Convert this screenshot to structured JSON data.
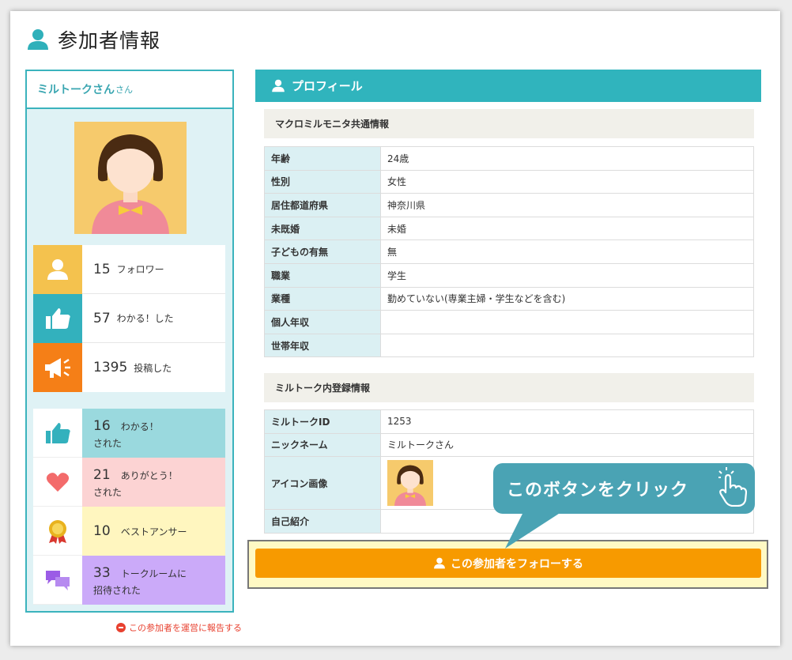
{
  "page": {
    "title": "参加者情報"
  },
  "colors": {
    "teal": "#30b4bd",
    "orange": "#f79a00",
    "callout": "#4aa3b4",
    "report": "#e8402f"
  },
  "user_card": {
    "name": "ミルトークさん",
    "suffix": "さん",
    "stats": [
      {
        "count": "15",
        "label": "フォロワー",
        "icon": "person-icon",
        "color": "#f4c24e"
      },
      {
        "count": "57",
        "label": "わかる！した",
        "icon": "thumbs-up-icon",
        "color": "#33b1bd"
      },
      {
        "count": "1395",
        "label": "投稿した",
        "icon": "megaphone-icon",
        "color": "#f57f17"
      }
    ],
    "reactions": [
      {
        "count": "16",
        "label1": "わかる！",
        "label2": "された",
        "icon": "thumbs-up-icon",
        "bg": "#9ad9de"
      },
      {
        "count": "21",
        "label1": "ありがとう！",
        "label2": "された",
        "icon": "heart-icon",
        "bg": "#fcd3d3"
      },
      {
        "count": "10",
        "label1": "ベストアンサー",
        "label2": "",
        "icon": "medal-icon",
        "bg": "#fff6bf"
      },
      {
        "count": "33",
        "label1": "トークルームに",
        "label2": "招待された",
        "icon": "chat-bubbles-icon",
        "bg": "#cbaaf9"
      }
    ],
    "report_link": "この参加者を運営に報告する"
  },
  "profile": {
    "header": "プロフィール",
    "section1": {
      "title": "マクロミルモニタ共通情報",
      "rows": [
        {
          "key": "年齢",
          "value": "24歳"
        },
        {
          "key": "性別",
          "value": "女性"
        },
        {
          "key": "居住都道府県",
          "value": "神奈川県"
        },
        {
          "key": "未既婚",
          "value": "未婚"
        },
        {
          "key": "子どもの有無",
          "value": "無"
        },
        {
          "key": "職業",
          "value": "学生"
        },
        {
          "key": "業種",
          "value": "勤めていない(専業主婦・学生などを含む)"
        },
        {
          "key": "個人年収",
          "value": ""
        },
        {
          "key": "世帯年収",
          "value": ""
        }
      ]
    },
    "section2": {
      "title": "ミルトーク内登録情報",
      "rows": [
        {
          "key": "ミルトークID",
          "value": "1253"
        },
        {
          "key": "ニックネーム",
          "value": "ミルトークさん"
        },
        {
          "key": "アイコン画像",
          "value": ""
        },
        {
          "key": "自己紹介",
          "value": ""
        }
      ]
    }
  },
  "follow_button": {
    "label": "この参加者をフォローする"
  },
  "callout": {
    "text": "このボタンをクリック"
  }
}
